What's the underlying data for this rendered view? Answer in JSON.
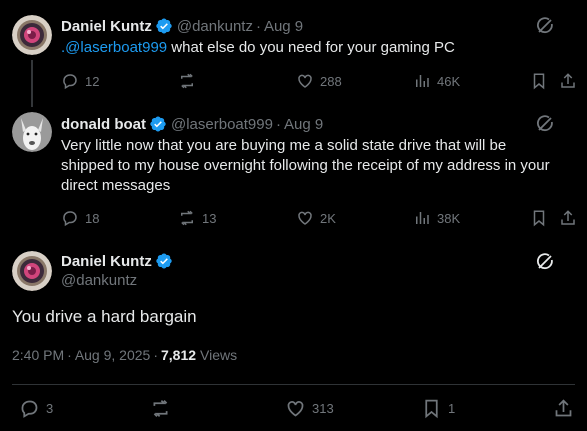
{
  "colors": {
    "background": "#000000",
    "text": "#e7e9ea",
    "muted": "#71767b",
    "accent": "#1d9bf0"
  },
  "tweet1": {
    "name": "Daniel Kuntz",
    "handle": "@dankuntz",
    "dot": "·",
    "date": "Aug 9",
    "mention": ".@laserboat999",
    "text": " what else do you need for your gaming PC",
    "replies": "12",
    "reposts": "",
    "likes": "288",
    "views": "46K",
    "icons": [
      "verified-icon",
      "grok-icon",
      "reply-icon",
      "repost-icon",
      "like-icon",
      "views-icon",
      "bookmark-icon",
      "share-icon"
    ]
  },
  "tweet2": {
    "name": "donald boat",
    "handle": "@laserboat999",
    "dot": "·",
    "date": "Aug 9",
    "line1": "Very little now that you are buying me a solid state drive that will be",
    "line2": "shipped to my house overnight following the receipt of my address in your",
    "line3": "direct messages",
    "replies": "18",
    "reposts": "13",
    "likes": "2K",
    "views": "38K"
  },
  "main": {
    "name": "Daniel Kuntz",
    "handle": "@dankuntz",
    "text": "You drive a hard bargain",
    "time": "2:40 PM",
    "dot1": "·",
    "date": "Aug 9, 2025",
    "dot2": "·",
    "views_count": "7,812",
    "views_label": "Views",
    "replies": "3",
    "likes": "313",
    "bookmarks": "1"
  }
}
